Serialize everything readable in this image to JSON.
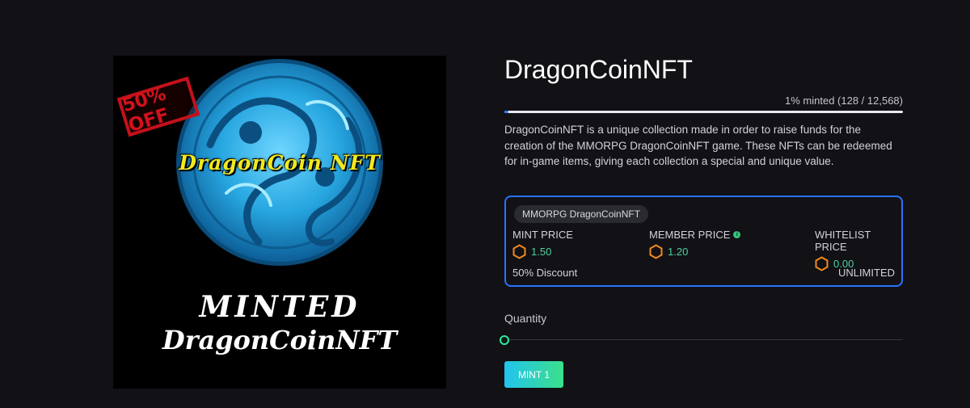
{
  "artwork": {
    "stamp_text": "50% OFF",
    "coin_text": "DragonCoin NFT",
    "minted_text": "MINTED",
    "minted_sub_text": "DragonCoinNFT"
  },
  "title": "DragonCoinNFT",
  "progress": {
    "text": "1% minted (128 / 12,568)",
    "minted": 128,
    "total": 12568,
    "fraction": 0.0102
  },
  "description": "DragonCoinNFT is a unique collection made in order to raise funds for the creation of the MMORPG DragonCoinNFT game. These NFTs can be redeemed for in-game items, giving each collection a special and unique value.",
  "card": {
    "chip": "MMORPG DragonCoinNFT",
    "prices": [
      {
        "label": "MINT PRICE",
        "value": "1.50",
        "icon": "hexagon-token-icon"
      },
      {
        "label": "MEMBER PRICE",
        "value": "1.20",
        "icon": "hexagon-token-icon",
        "info": "i"
      },
      {
        "label": "WHITELIST PRICE",
        "value": "0.00",
        "icon": "hexagon-token-icon"
      }
    ],
    "discount": "50% Discount",
    "limit": "UNLIMITED"
  },
  "quantity": {
    "label": "Quantity",
    "value": 1
  },
  "mint_button": "MINT 1",
  "colors": {
    "background": "#111116",
    "accent_blue": "#2a73ff",
    "price_green": "#4fd1a0",
    "token_orange": "#f08a1c",
    "button_gradient_start": "#22c4ee",
    "button_gradient_end": "#3be08a"
  }
}
